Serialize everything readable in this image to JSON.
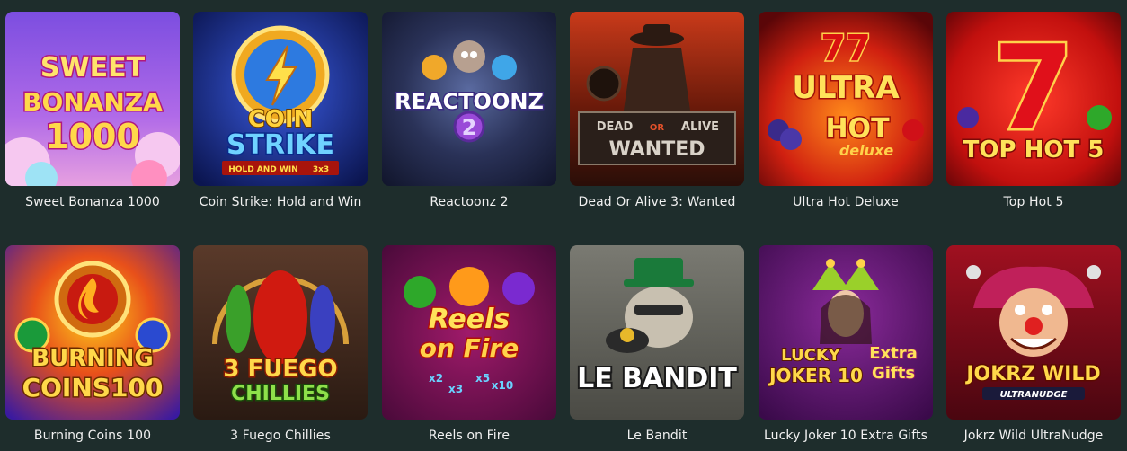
{
  "games": [
    {
      "title": "Sweet Bonanza 1000",
      "logo_lines": [
        "SWEET",
        "BONANZA",
        "1000"
      ]
    },
    {
      "title": "Coin Strike: Hold and Win",
      "logo_lines": [
        "COIN",
        "STRIKE",
        "HOLD AND WIN",
        "3x3"
      ]
    },
    {
      "title": "Reactoonz 2",
      "logo_lines": [
        "REACTOONZ",
        "2"
      ]
    },
    {
      "title": "Dead Or Alive 3: Wanted",
      "logo_lines": [
        "DEAD",
        "OR",
        "ALIVE",
        "WANTED"
      ]
    },
    {
      "title": "Ultra Hot Deluxe",
      "logo_lines": [
        "77",
        "ULTRA",
        "HOT",
        "deluxe"
      ]
    },
    {
      "title": "Top Hot 5",
      "logo_lines": [
        "7",
        "TOP HOT 5"
      ]
    },
    {
      "title": "Burning Coins 100",
      "logo_lines": [
        "BURNING",
        "COINS100"
      ]
    },
    {
      "title": "3 Fuego Chillies",
      "logo_lines": [
        "3 FUEGO",
        "CHILLIES"
      ]
    },
    {
      "title": "Reels on Fire",
      "logo_lines": [
        "Reels",
        "on Fire",
        "x2",
        "x3",
        "x5",
        "x10"
      ]
    },
    {
      "title": "Le Bandit",
      "logo_lines": [
        "LE BANDIT"
      ]
    },
    {
      "title": "Lucky Joker 10 Extra Gifts",
      "logo_lines": [
        "LUCKY",
        "JOKER 10",
        "Extra",
        "Gifts"
      ]
    },
    {
      "title": "Jokrz Wild UltraNudge",
      "logo_lines": [
        "JOKRZ WILD",
        "ULTRANUDGE"
      ]
    }
  ],
  "colors": {
    "background": "#1e2d2c",
    "caption": "#f1f1f1"
  }
}
